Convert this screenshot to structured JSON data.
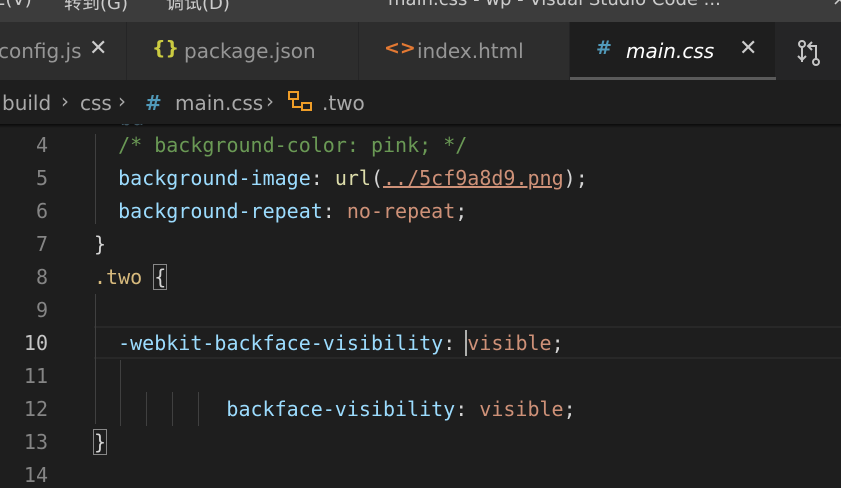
{
  "titlebar": {
    "menu_left": "Ё(V)",
    "menu_goto": "转到(G)",
    "menu_debug": "调试(D)",
    "window_title": "main.css - wp - Visual Studio Code ...",
    "close_glyph": "×"
  },
  "tabs": [
    {
      "label": "config.js",
      "icon": "",
      "close": "✕"
    },
    {
      "label": "package.json",
      "icon": "{}",
      "close": ""
    },
    {
      "label": "index.html",
      "icon": "<>",
      "close": ""
    },
    {
      "label": "main.css",
      "icon": "#",
      "close": "✕"
    }
  ],
  "breadcrumb": {
    "items": [
      "build",
      "css",
      "main.css",
      ".two"
    ],
    "sep": "›",
    "file_icon": "#"
  },
  "editor": {
    "lines": [
      {
        "n": "4",
        "indent": "  ",
        "comment": "/* background-color: pink; */"
      },
      {
        "n": "5",
        "indent": "  ",
        "prop": "background-image",
        "colon": ": ",
        "fn": "url",
        "open": "(",
        "url": "../5cf9a8d9.png",
        "close": ")",
        "semi": ";"
      },
      {
        "n": "6",
        "indent": "  ",
        "prop": "background-repeat",
        "colon": ": ",
        "val": "no-repeat",
        "semi": ";"
      },
      {
        "n": "7",
        "text": "}"
      },
      {
        "n": "8",
        "selector": ".two",
        "space": " ",
        "brace": "{"
      },
      {
        "n": "9"
      },
      {
        "n": "10",
        "indent": "  ",
        "prop": "-webkit-backface-visibility",
        "colon": ": ",
        "val": "visible",
        "semi": ";"
      },
      {
        "n": "11"
      },
      {
        "n": "12",
        "indent": "          ",
        "prop": "backface-visibility",
        "colon": ": ",
        "val": "visible",
        "semi": ";"
      },
      {
        "n": "13",
        "text": "}"
      },
      {
        "n": "14"
      }
    ]
  },
  "colors": {
    "comment": "#6a9955",
    "property": "#9cdcfe",
    "value": "#ce9178",
    "function": "#dcdcaa",
    "selector": "#d7ba7d",
    "css_icon": "#519aba",
    "json_icon": "#cbcb41",
    "html_icon": "#e37933"
  }
}
